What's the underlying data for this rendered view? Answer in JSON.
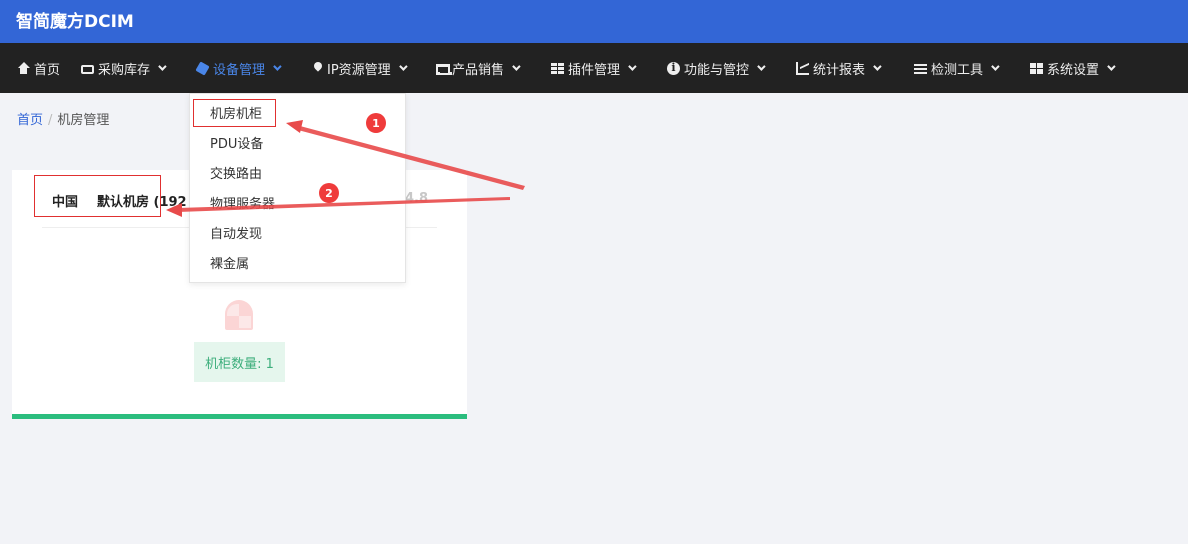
{
  "app": {
    "title": "智简魔方DCIM"
  },
  "nav": {
    "items": [
      {
        "label": "首页",
        "icon": "home-icon"
      },
      {
        "label": "采购库存",
        "icon": "inbox-icon"
      },
      {
        "label": "设备管理",
        "icon": "cube-icon",
        "active": true
      },
      {
        "label": "IP资源管理",
        "icon": "map-marker-icon"
      },
      {
        "label": "产品销售",
        "icon": "cart-icon"
      },
      {
        "label": "插件管理",
        "icon": "grid-icon"
      },
      {
        "label": "功能与管控",
        "icon": "info-circle-icon"
      },
      {
        "label": "统计报表",
        "icon": "line-chart-icon"
      },
      {
        "label": "检测工具",
        "icon": "list-icon"
      },
      {
        "label": "系统设置",
        "icon": "th-large-icon"
      }
    ]
  },
  "dropdown": {
    "items": [
      "机房机柜",
      "PDU设备",
      "交换路由",
      "物理服务器",
      "自动发现",
      "裸金属"
    ]
  },
  "breadcrumb": {
    "home": "首页",
    "separator": "/",
    "current": "机房管理"
  },
  "room_card": {
    "country": "中国",
    "room_name": "默认机房 (192",
    "suffix": "4.8",
    "rack_count": "机柜数量: 1"
  },
  "annotations": {
    "step1": "1",
    "step2": "2"
  },
  "colors": {
    "topbar": "#3366d6",
    "navbar": "#222222",
    "active": "#4a86e8",
    "card_accent": "#2bbd7e",
    "annotation": "#ef3b3b"
  }
}
